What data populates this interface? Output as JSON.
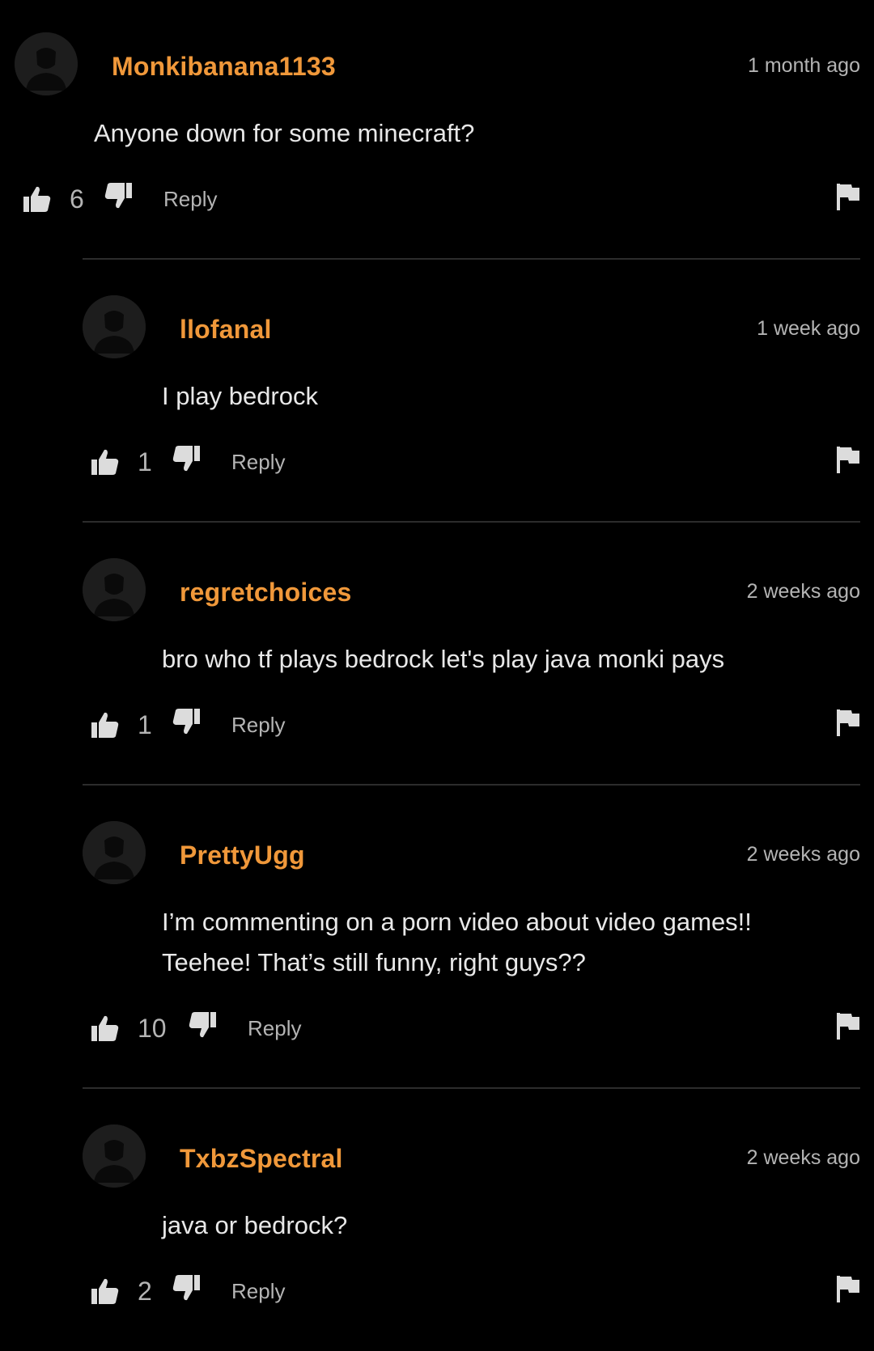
{
  "theme": {
    "background": "#000000",
    "username_color": "#f0983a",
    "muted_text": "#b4b4b4",
    "icon_color": "#dcdcdc"
  },
  "comments": [
    {
      "username": "Monkibanana1133",
      "timestamp": "1 month ago",
      "text": "Anyone down for some minecraft?",
      "votes": "6",
      "reply_label": "Reply"
    },
    {
      "username": "llofanal",
      "timestamp": "1 week ago",
      "text": "I play bedrock",
      "votes": "1",
      "reply_label": "Reply"
    },
    {
      "username": "regretchoices",
      "timestamp": "2 weeks ago",
      "text": "bro who tf plays bedrock let's play java monki pays",
      "votes": "1",
      "reply_label": "Reply"
    },
    {
      "username": "PrettyUgg",
      "timestamp": "2 weeks ago",
      "text": "I’m commenting on a porn video about video games!!\nTeehee! That’s still funny, right guys??",
      "votes": "10",
      "reply_label": "Reply"
    },
    {
      "username": "TxbzSpectral",
      "timestamp": "2 weeks ago",
      "text": "java or bedrock?",
      "votes": "2",
      "reply_label": "Reply"
    }
  ]
}
